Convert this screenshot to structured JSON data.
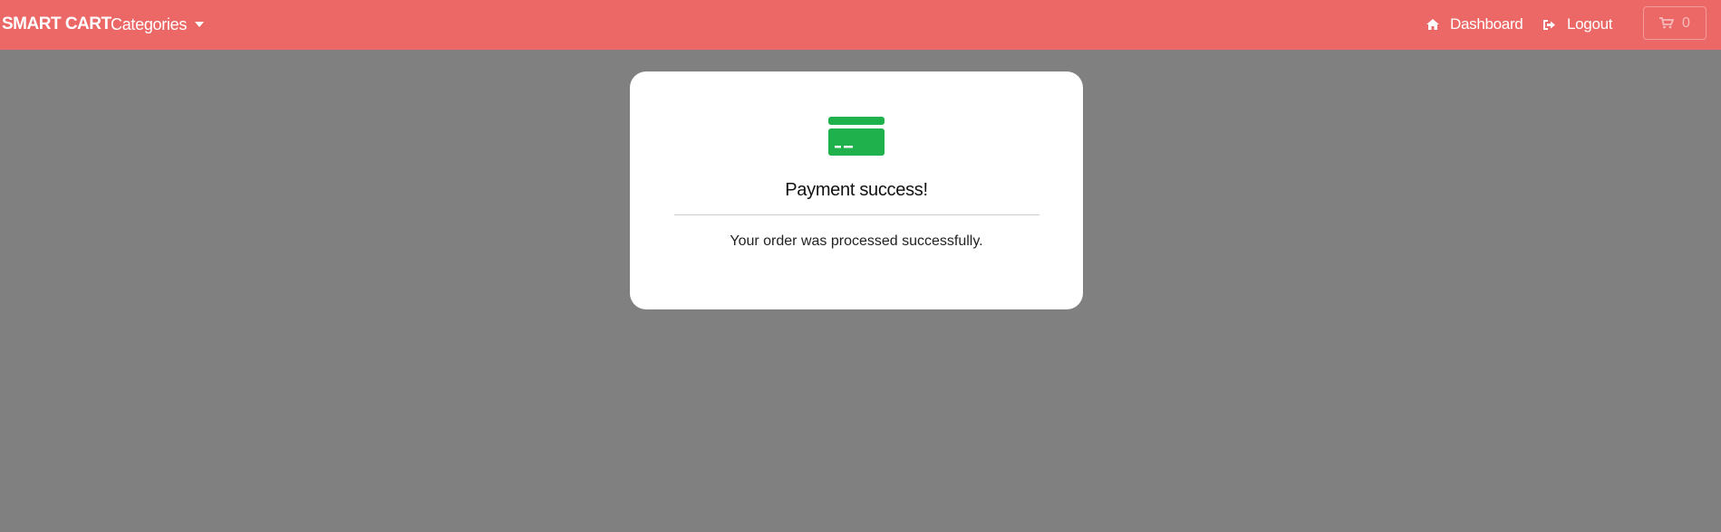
{
  "navbar": {
    "brand": "SMART CART",
    "categories_label": "Categories",
    "dashboard_label": "Dashboard",
    "logout_label": "Logout",
    "cart_count": "0",
    "background_color": "#ec6866"
  },
  "icons": {
    "dashboard": "home-icon",
    "logout": "sign-out-icon",
    "cart": "shopping-cart-icon",
    "payment": "credit-card-icon"
  },
  "card": {
    "title": "Payment success!",
    "message": "Your order was processed successfully.",
    "icon_color": "#1fb14c"
  },
  "page": {
    "background_color": "#808080"
  }
}
